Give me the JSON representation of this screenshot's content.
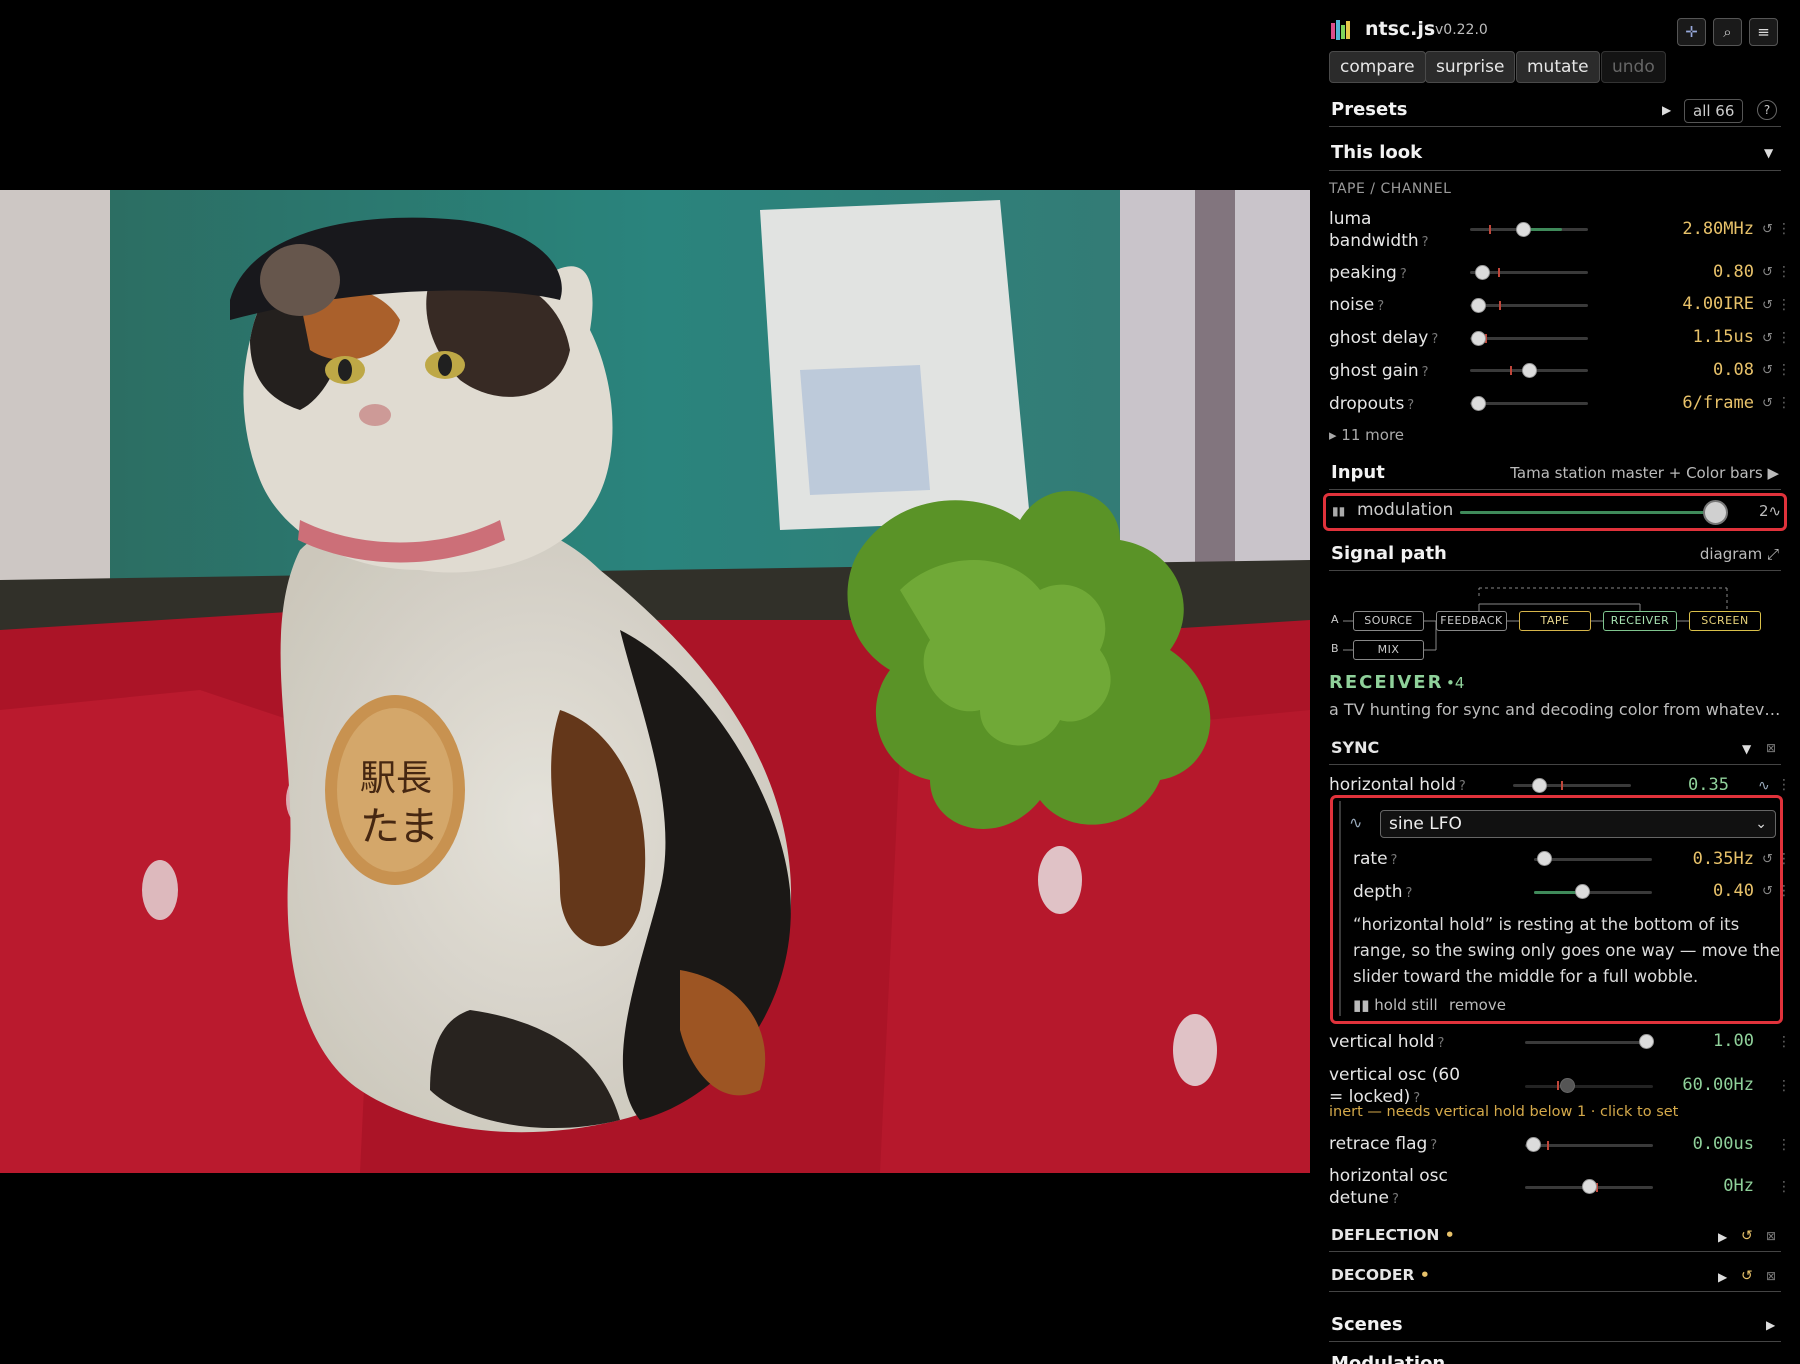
{
  "app": {
    "name": "ntsc.js",
    "version": "v0.22.0"
  },
  "toolbar": {
    "compare": "compare",
    "surprise": "surprise",
    "mutate": "mutate",
    "undo": "undo"
  },
  "presets": {
    "title": "Presets",
    "all_label": "all 66",
    "help": "?"
  },
  "this_look": {
    "title": "This look",
    "group": "TAPE / CHANNEL",
    "params": [
      {
        "label": "luma bandwidth",
        "value": "2.80MHz",
        "level": 0.45
      },
      {
        "label": "peaking",
        "value": "0.80",
        "level": 0.12
      },
      {
        "label": "noise",
        "value": "4.00IRE",
        "level": 0.08
      },
      {
        "label": "ghost delay",
        "value": "1.15us",
        "level": 0.08
      },
      {
        "label": "ghost gain",
        "value": "0.08",
        "level": 0.52
      },
      {
        "label": "dropouts",
        "value": "6/frame",
        "level": 0.07
      }
    ],
    "more": "▸ 11 more"
  },
  "input": {
    "title": "Input",
    "source": "Tama station master + Color bars ▶",
    "modulation_label": "modulation",
    "modulation_value": "2∿",
    "modulation_level": 0.97
  },
  "signal_path": {
    "title": "Signal path",
    "diagram_link": "diagram ⤢",
    "row_a": "A",
    "row_b": "B",
    "nodes": {
      "source": "SOURCE",
      "feedback": "FEEDBACK",
      "tape": "TAPE",
      "receiver": "RECEIVER",
      "screen": "SCREEN",
      "mix": "MIX"
    }
  },
  "receiver": {
    "title": "RECEIVER",
    "count": "•4",
    "desc": "a TV hunting for sync and decoding color from whatev…"
  },
  "sync": {
    "title": "SYNC",
    "horizontal_hold": {
      "label": "horizontal hold",
      "value": "0.35",
      "level": 0.2
    },
    "lfo": {
      "type": "sine LFO",
      "rate": {
        "label": "rate",
        "value": "0.35Hz",
        "level": 0.08
      },
      "depth": {
        "label": "depth",
        "value": "0.40",
        "level": 0.4
      },
      "note": "“horizontal hold” is resting at the bottom of its range, so the swing only goes one way — move the slider toward the middle for a full wobble.",
      "hold_still": "▮▮ hold still",
      "remove": "remove"
    },
    "vertical_hold": {
      "label": "vertical hold",
      "value": "1.00",
      "level": 0.95
    },
    "vertical_osc": {
      "label": "vertical osc (60 = locked)",
      "value": "60.00Hz",
      "level": 0.32
    },
    "inert_note": "inert — needs vertical hold below 1 · click to set",
    "retrace_flag": {
      "label": "retrace flag",
      "value": "0.00us",
      "level": 0.05
    },
    "horizontal_osc_detune": {
      "label": "horizontal osc detune",
      "value": "0Hz",
      "level": 0.5
    }
  },
  "deflection": {
    "title": "DEFLECTION",
    "dot": "•"
  },
  "decoder": {
    "title": "DECODER",
    "dot": "•"
  },
  "scenes": {
    "title": "Scenes"
  },
  "modulation_section": {
    "title": "Modulation"
  },
  "colors": {
    "accent_green": "#8fd19a",
    "value_gold": "#e8c26a",
    "highlight_red": "#e0323b",
    "background": "#000000"
  },
  "icons": [
    "logo-icon",
    "crosshair-icon",
    "search-icon",
    "menu-icon",
    "pause-icon",
    "wave-icon",
    "reset-icon",
    "more-icon",
    "chevron-down-icon",
    "expand-icon"
  ]
}
